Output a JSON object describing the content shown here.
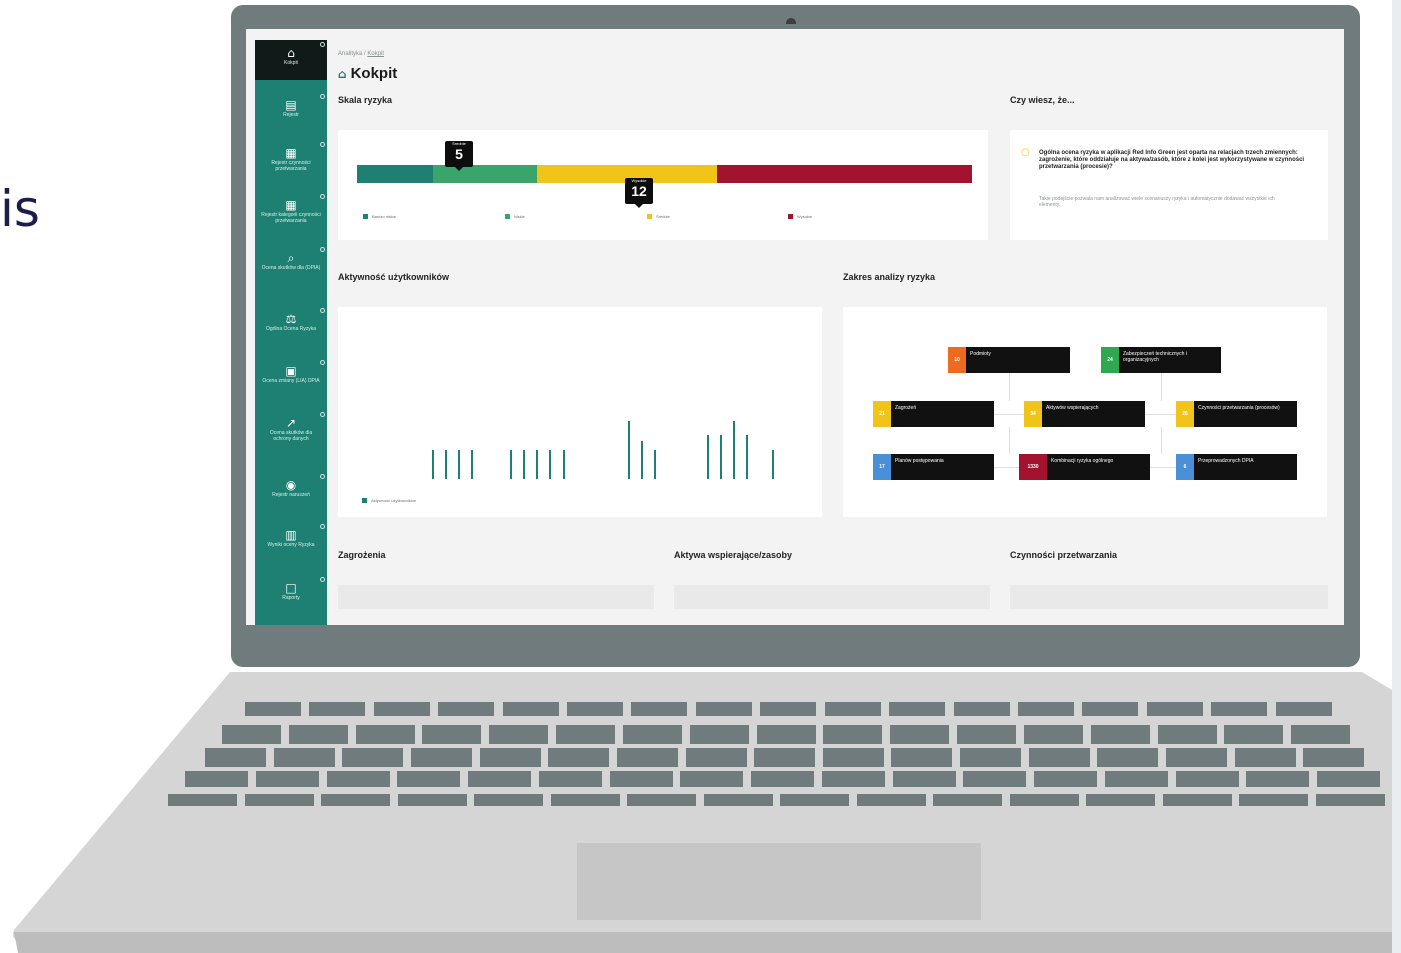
{
  "background_text": "is",
  "app": {
    "breadcrumb": {
      "root": "Analityka",
      "current": "Kokpit"
    },
    "page_title": "Kokpit",
    "sidebar": {
      "items": [
        {
          "label": "Kokpit",
          "icon": "home-icon"
        },
        {
          "label": "Rejestr",
          "icon": "register-icon"
        },
        {
          "label": "Rejestr czynności przetwarzania",
          "icon": "table-icon"
        },
        {
          "label": "Rejestr kategorii czynności przetwarzania",
          "icon": "table-icon"
        },
        {
          "label": "Ocena skutków dla (DPIA)",
          "icon": "search-icon"
        },
        {
          "label": "Ogólna Ocena Ryzyka",
          "icon": "scale-icon"
        },
        {
          "label": "Ocena zmiany (LIA) DPIA",
          "icon": "grid-icon"
        },
        {
          "label": "Ocena skutków dla ochrony danych",
          "icon": "chart-icon"
        },
        {
          "label": "Rejestr naruszeń",
          "icon": "eye-icon"
        },
        {
          "label": "Wyniki oceny Ryzyka",
          "icon": "report-icon"
        },
        {
          "label": "Raporty",
          "icon": "document-icon"
        }
      ]
    },
    "risk_scale": {
      "title": "Skala ryzyka",
      "subtitle": "Skala ryzyka",
      "colors": {
        "low": "#1e8072",
        "mid": "#3aa56b",
        "high": "#f0c419",
        "critical": "#a3122e"
      },
      "markers": [
        {
          "label": "Średnie",
          "value": "5"
        },
        {
          "label": "Wysokie",
          "value": "12"
        }
      ],
      "legend": [
        {
          "name": "Bardzo niskie",
          "color": "#1e8072"
        },
        {
          "name": "Niskie",
          "color": "#3aa56b"
        },
        {
          "name": "Średnie",
          "color": "#f0c419"
        },
        {
          "name": "Wysokie",
          "color": "#a3122e"
        }
      ]
    },
    "did_you_know": {
      "title": "Czy wiesz, że...",
      "headline": "Ogólna ocena ryzyka w aplikacji Red Info Green jest oparta na relacjach trzech zmiennych: zagrożenie, które oddziałuje na aktywa/zasób, które z kolei jest wykorzystywane w czynności przetwarzania (procesie)?",
      "body": "Takie podejście pozwala nam analizować wiele scenariuszy ryzyka i automatycznie dodawać wszystkie ich elementy."
    },
    "user_activity": {
      "title": "Aktywność użytkowników",
      "legend": "Aktywność użytkowników"
    },
    "risk_scope": {
      "title": "Zakres analizy ryzyka",
      "nodes": [
        {
          "count": "10",
          "label": "Podmioty",
          "color": "#ee6a1e"
        },
        {
          "count": "24",
          "label": "Zabezpieczeń technicznych i organizacyjnych",
          "color": "#2fa84f"
        },
        {
          "count": "21",
          "label": "Zagrożeń",
          "color": "#f0c419"
        },
        {
          "count": "34",
          "label": "Aktywów wspierających",
          "color": "#f0c419"
        },
        {
          "count": "26",
          "label": "Czynności przetwarzania (procesów)",
          "color": "#f0c419"
        },
        {
          "count": "17",
          "label": "Planów postępowania",
          "color": "#4a90d9"
        },
        {
          "count": "1330",
          "label": "Kombinacji ryzyka ogólnego",
          "color": "#a3122e"
        },
        {
          "count": "6",
          "label": "Przeprowadzonych DPIA",
          "color": "#4a90d9"
        }
      ]
    },
    "bottom_sections": [
      {
        "title": "Zagrożenia"
      },
      {
        "title": "Aktywa wspierające/zasoby"
      },
      {
        "title": "Czynności przetwarzania"
      }
    ]
  },
  "chart_data": {
    "type": "bar",
    "title": "Aktywność użytkowników",
    "series": [
      {
        "name": "Aktywność użytkowników",
        "values": [
          0,
          0,
          0,
          0,
          0,
          1,
          1,
          1,
          1,
          0,
          0,
          1,
          1,
          1,
          1,
          1,
          0,
          0,
          0,
          0,
          2,
          1.3,
          1,
          0,
          0,
          0,
          1.5,
          1.5,
          2,
          1.5,
          0,
          1,
          0
        ]
      }
    ],
    "ylim": [
      0,
      5
    ]
  }
}
